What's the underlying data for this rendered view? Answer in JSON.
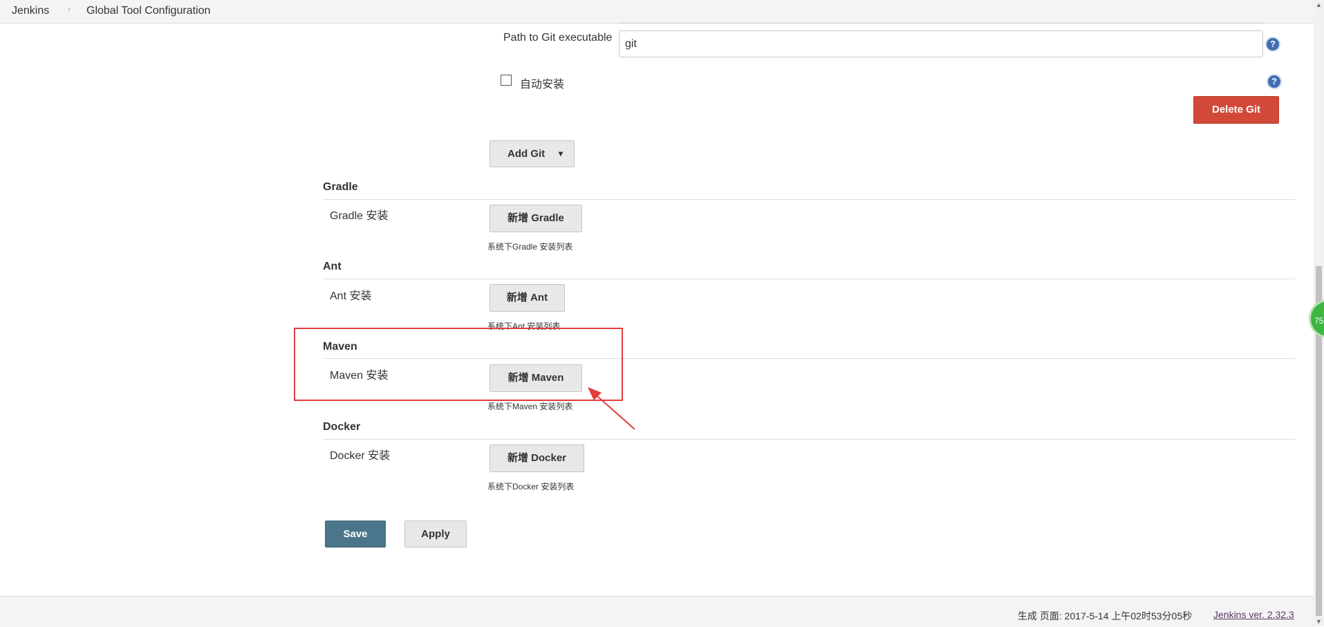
{
  "breadcrumb": {
    "items": [
      "Jenkins",
      "Global Tool Configuration"
    ],
    "separator": "›"
  },
  "git": {
    "path_label": "Path to Git executable",
    "path_value": "git",
    "auto_install_label": "自动安装",
    "help_glyph": "?",
    "delete_button": "Delete Git",
    "add_button": "Add Git",
    "dropdown_glyph": "▾"
  },
  "sections": {
    "gradle": {
      "title": "Gradle",
      "label": "Gradle 安装",
      "button": "新增 Gradle",
      "desc": "系统下Gradle 安装列表"
    },
    "ant": {
      "title": "Ant",
      "label": "Ant 安装",
      "button": "新增 Ant",
      "desc": "系统下Ant 安装列表"
    },
    "maven": {
      "title": "Maven",
      "label": "Maven 安装",
      "button": "新增 Maven",
      "desc": "系统下Maven 安装列表"
    },
    "docker": {
      "title": "Docker",
      "label": "Docker 安装",
      "button": "新增 Docker",
      "desc": "系统下Docker 安装列表"
    }
  },
  "actions": {
    "save": "Save",
    "apply": "Apply"
  },
  "footer": {
    "generated": "生成 页面: 2017-5-14 上午02时53分05秒",
    "version_link": "Jenkins ver. 2.32.3"
  },
  "overlay": {
    "badge_text": "75"
  },
  "colors": {
    "delete_button": "#d24939",
    "save_button": "#4b758b",
    "annotation": "#e23b3b",
    "help_icon": "#3f6fb1",
    "badge": "#3fb542"
  }
}
